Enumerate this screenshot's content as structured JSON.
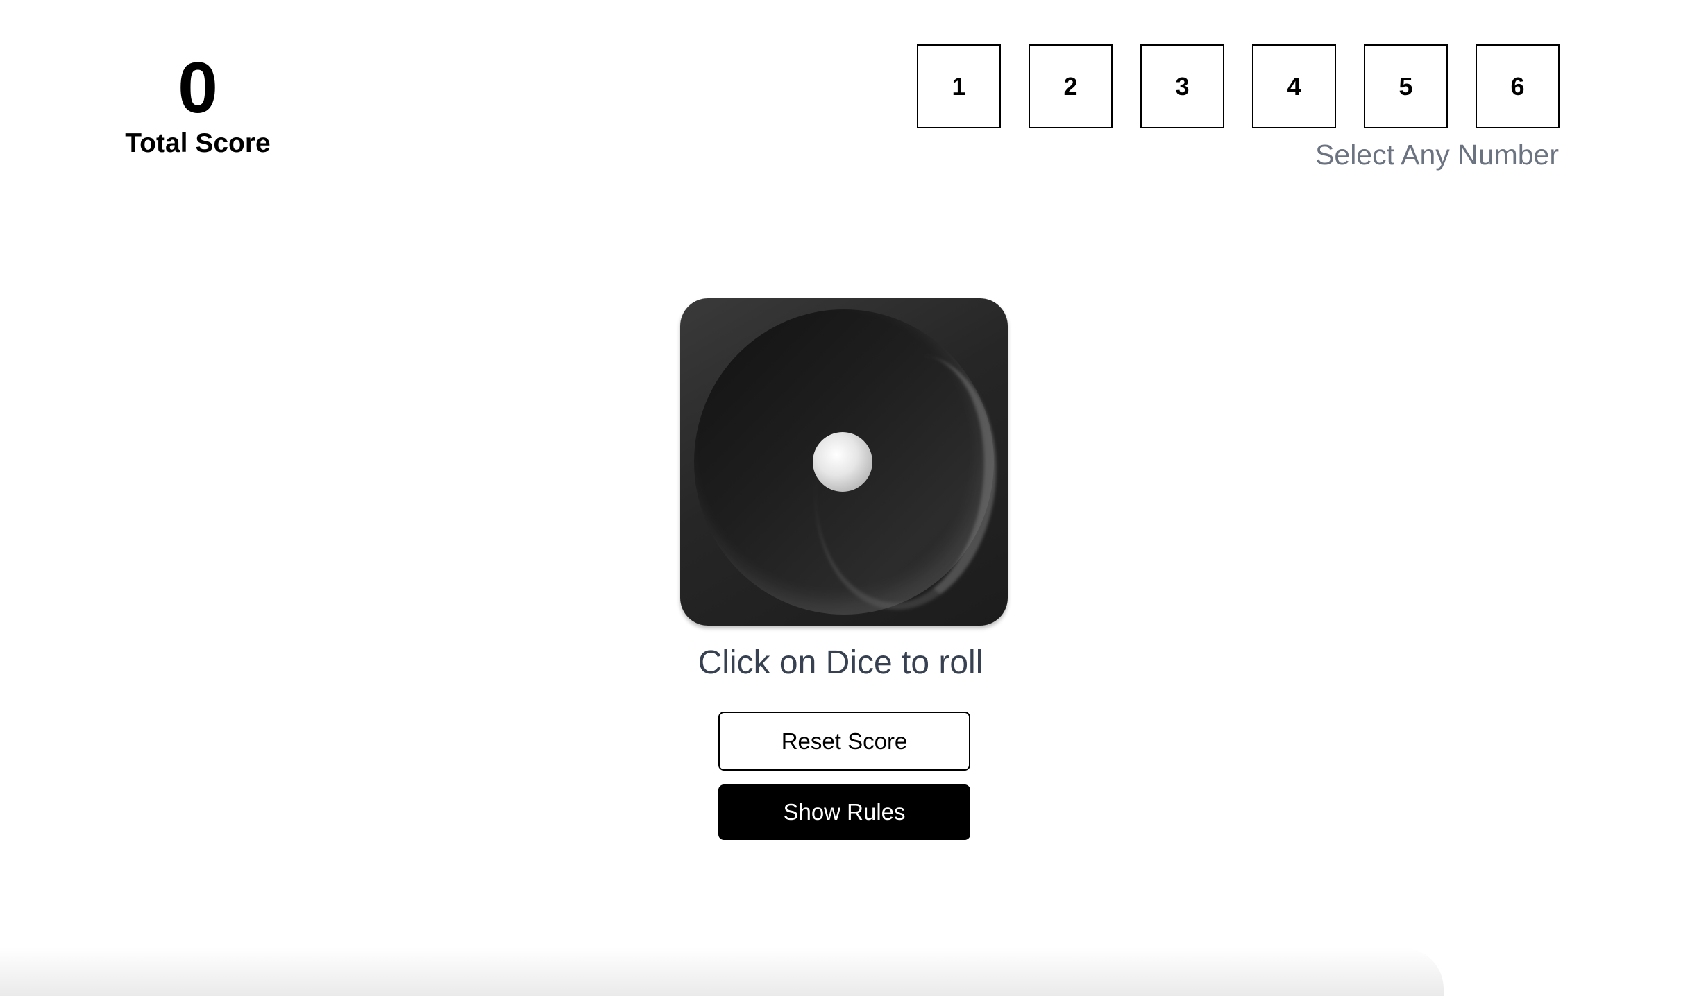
{
  "score": {
    "value": "0",
    "label": "Total Score"
  },
  "number_selector": {
    "options": [
      "1",
      "2",
      "3",
      "4",
      "5",
      "6"
    ],
    "hint": "Select Any Number"
  },
  "dice": {
    "current_face": 1,
    "icon": "dice-one-icon",
    "roll_hint": "Click on Dice to roll"
  },
  "buttons": {
    "reset_label": "Reset Score",
    "rules_label": "Show Rules"
  },
  "colors": {
    "primary": "#000000",
    "hint_text": "#6b7280",
    "roll_hint_text": "#374151",
    "background": "#ffffff"
  }
}
